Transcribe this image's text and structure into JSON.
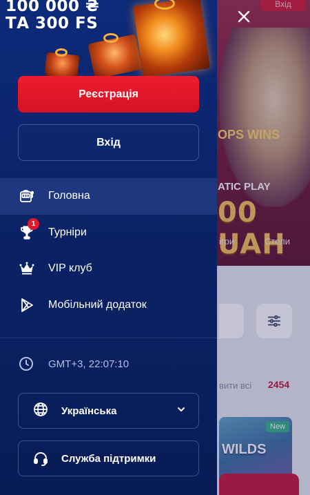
{
  "promo": {
    "line1": "100 000 ₴",
    "line2": "ТА 300 FS"
  },
  "auth": {
    "register_label": "Реєстрація",
    "login_label": "Вхід"
  },
  "menu": {
    "items": [
      {
        "label": "Головна",
        "icon": "slot-machine-icon",
        "active": true
      },
      {
        "label": "Турніри",
        "icon": "trophy-icon",
        "badge": "1"
      },
      {
        "label": "VIP клуб",
        "icon": "crown-icon"
      },
      {
        "label": "Мобільний додаток",
        "icon": "play-store-icon"
      }
    ]
  },
  "clock": {
    "text": "GMT+3, 22:07:10",
    "icon": "clock-icon"
  },
  "language": {
    "selected": "Українська",
    "icon": "globe-icon"
  },
  "support": {
    "label": "Служба підтримки",
    "icon": "headset-icon"
  },
  "background": {
    "top_button": "Вхід",
    "hero_small": "OPS WINS",
    "hero_play": "ATIC PLAY",
    "hero_amount": "00 UAH",
    "nav_games": "ігри",
    "nav_tables": "Столи",
    "show_all": "вити всі",
    "count": "2454",
    "new_badge": "New",
    "card_text": "WILDS"
  },
  "colors": {
    "drawer_bg": "#0a2266",
    "accent_red": "#e3182d",
    "text_muted": "#b3bfe3"
  }
}
